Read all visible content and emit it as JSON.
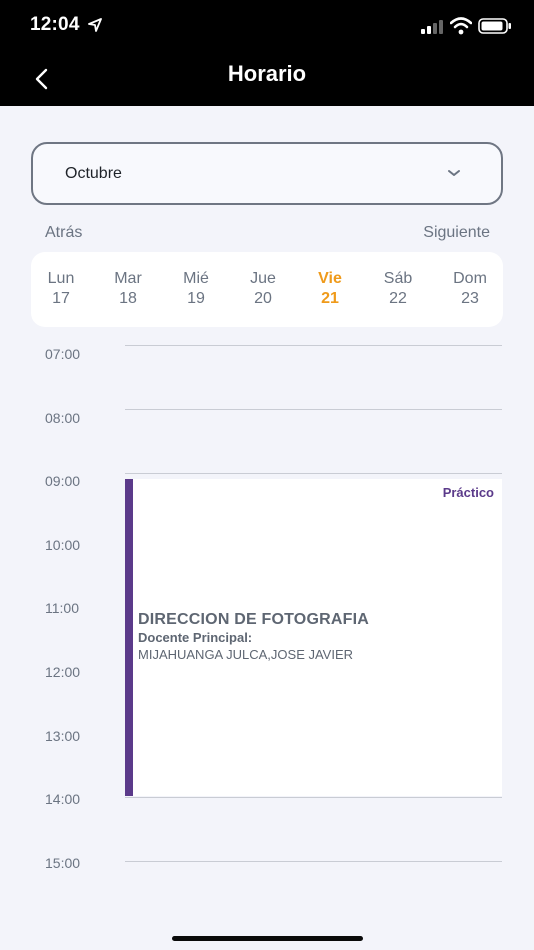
{
  "status_bar": {
    "time": "12:04",
    "icons": [
      "location-arrow-icon",
      "cell-signal-icon",
      "wifi-icon",
      "battery-icon"
    ]
  },
  "header": {
    "title": "Horario",
    "back_icon": "chevron-left-icon"
  },
  "month_select": {
    "value": "Octubre",
    "icon": "chevron-down-icon"
  },
  "nav": {
    "prev": "Atrás",
    "next": "Siguiente"
  },
  "week": {
    "days": [
      {
        "name": "Lun",
        "date": "17"
      },
      {
        "name": "Mar",
        "date": "18"
      },
      {
        "name": "Mié",
        "date": "19"
      },
      {
        "name": "Jue",
        "date": "20"
      },
      {
        "name": "Vie",
        "date": "21"
      },
      {
        "name": "Sáb",
        "date": "22"
      },
      {
        "name": "Dom",
        "date": "23"
      }
    ],
    "selected": "Vie"
  },
  "timeline": {
    "hours": [
      "07:00",
      "08:00",
      "09:00",
      "10:00",
      "11:00",
      "12:00",
      "13:00",
      "14:00",
      "15:00"
    ]
  },
  "event": {
    "type": "Práctico",
    "title": "DIRECCION DE FOTOGRAFIA",
    "role": "Docente Principal:",
    "teacher": "MIJAHUANGA JULCA,JOSE JAVIER",
    "start": "09:00",
    "end": "14:00"
  },
  "colors": {
    "accent": "#ef9a1a",
    "event": "#5b3a8a",
    "header_bg": "#000000"
  }
}
